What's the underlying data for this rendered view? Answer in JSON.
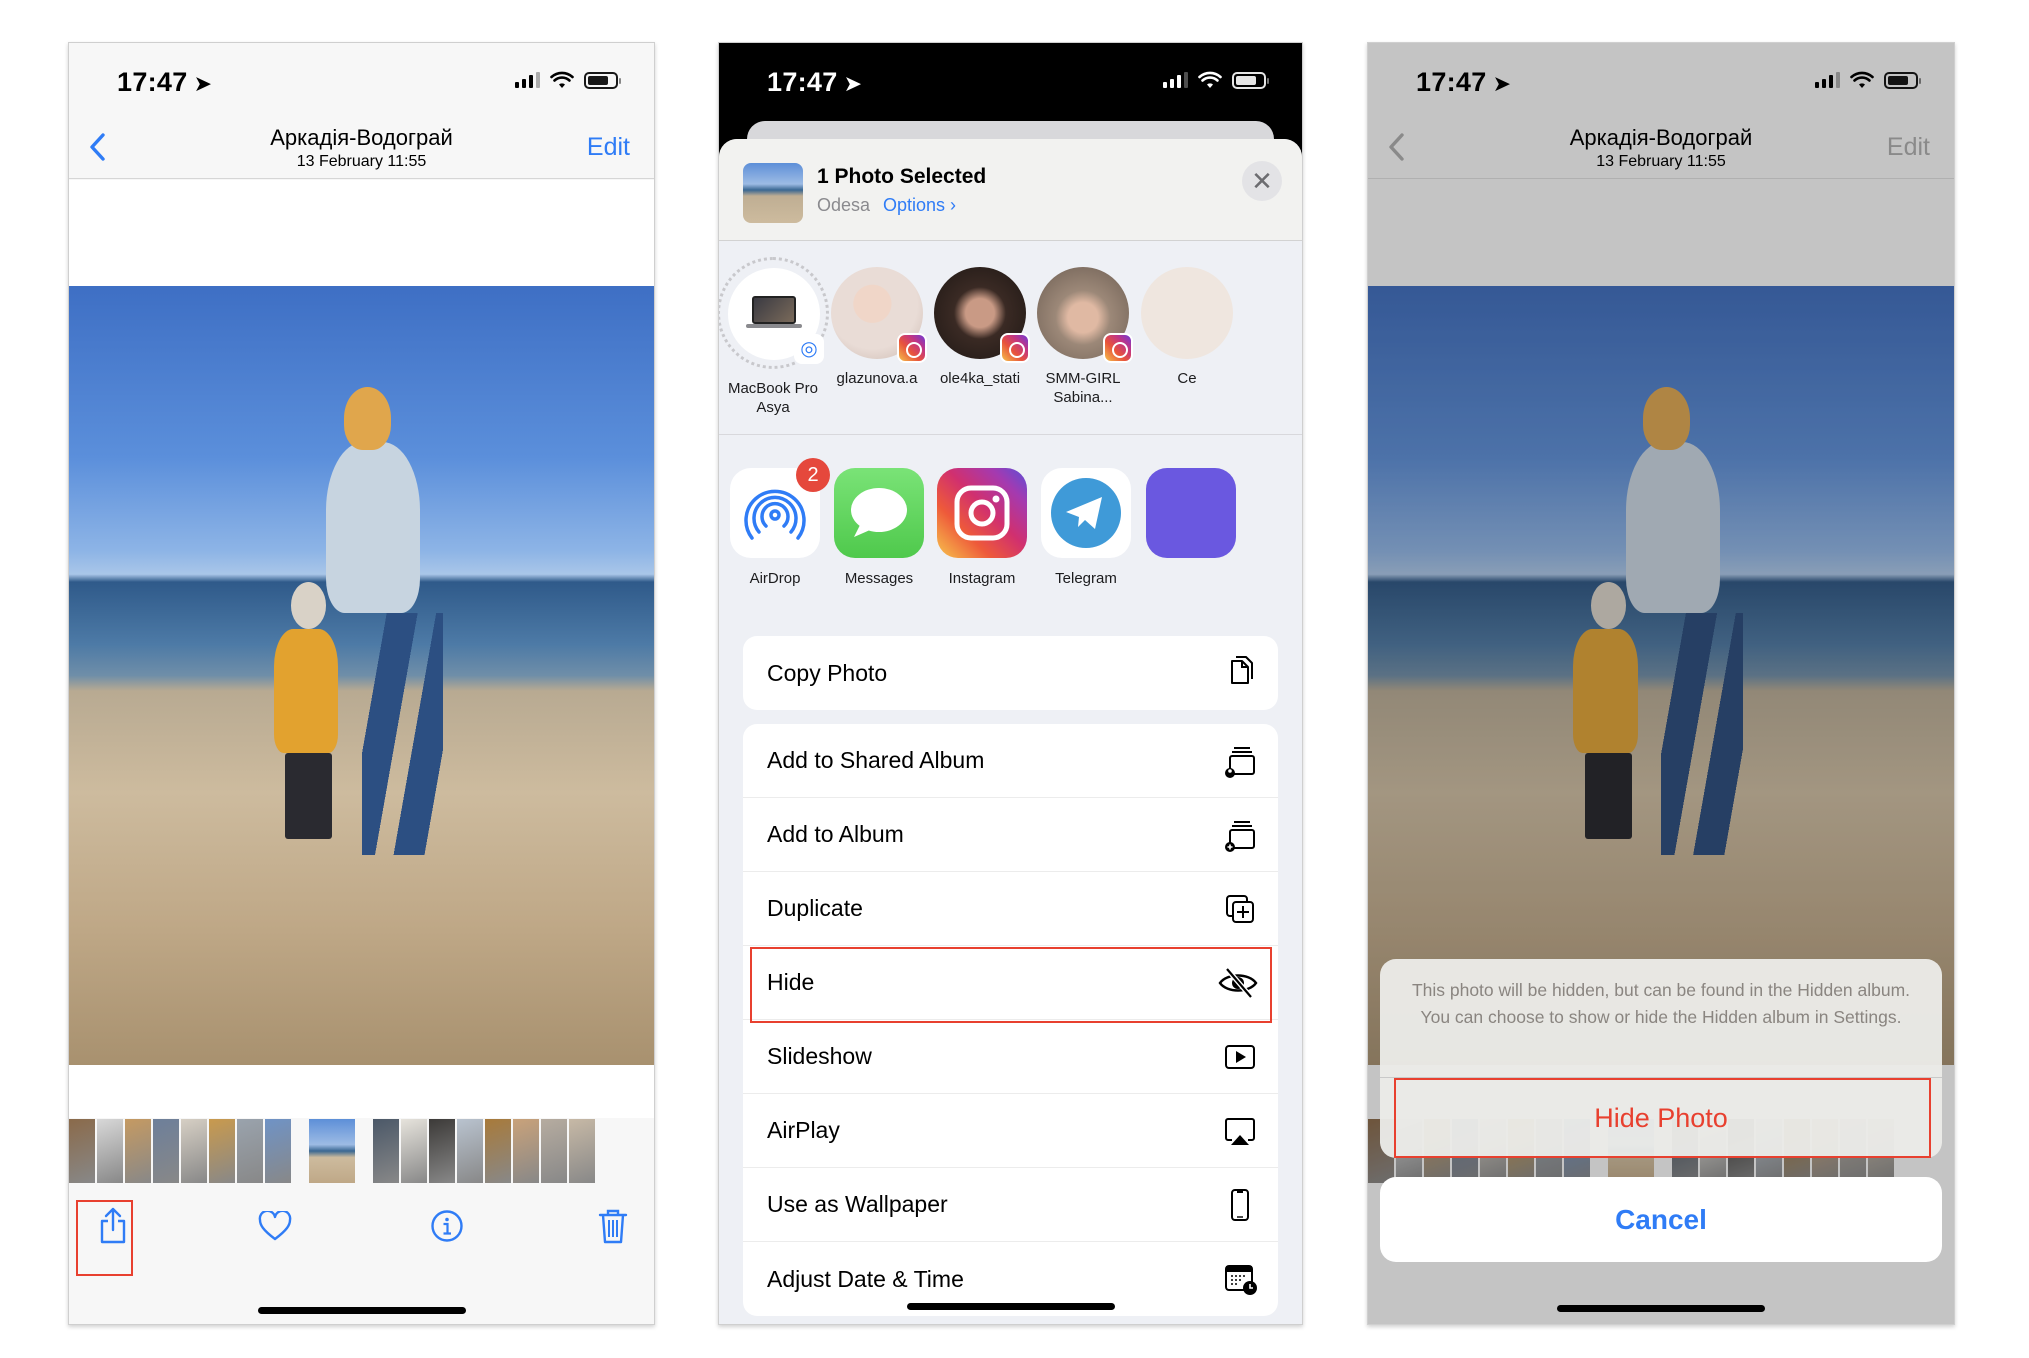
{
  "status_bar": {
    "time": "17:47",
    "location_icon": "location-arrow-icon"
  },
  "photo_view": {
    "title": "Аркадія-Водограй",
    "subtitle": "13 February  11:55",
    "back_icon": "chevron-left-icon",
    "edit_label": "Edit",
    "toolbar": [
      {
        "name": "share-button",
        "icon": "share-icon"
      },
      {
        "name": "favorite-button",
        "icon": "heart-icon"
      },
      {
        "name": "info-button",
        "icon": "info-icon"
      },
      {
        "name": "delete-button",
        "icon": "trash-icon"
      }
    ],
    "thumbnail_colors": [
      "#8a6a4a",
      "#d8d8d8",
      "#c59a62",
      "#6d7f9a",
      "#d6cfc4",
      "#c99a4d",
      "#9aa3ad",
      "#6f93c6",
      "gap",
      "#6f93c6",
      "gap",
      "#4b5868",
      "#e6e3dc",
      "#3c3a38",
      "#b9c3cf",
      "#a87a3a",
      "#c9a27a",
      "#b6aca0",
      "#c7b9a6"
    ]
  },
  "share_sheet": {
    "title": "1 Photo Selected",
    "location": "Odesa",
    "options_label": "Options ›",
    "close_icon": "close-icon",
    "people": [
      {
        "name": "MacBook Pro\nAsya",
        "line1": "MacBook Pro",
        "line2": "Asya",
        "type": "airdrop-device"
      },
      {
        "name": "glazunova.a",
        "line1": "glazunova.a",
        "line2": "",
        "type": "instagram",
        "color": "#e9dcd6"
      },
      {
        "name": "ole4ka_stati",
        "line1": "ole4ka_stati",
        "line2": "",
        "type": "instagram",
        "color": "#3a2a24"
      },
      {
        "name": "SMM-GIRL Sabina...",
        "line1": "SMM-GIRL",
        "line2": "Sabina...",
        "type": "instagram",
        "color": "#9c8878"
      },
      {
        "name": "Ce",
        "line1": "Ce",
        "line2": "",
        "type": "partial",
        "color": "#efe6df"
      }
    ],
    "apps": [
      {
        "name": "AirDrop",
        "badge": "2"
      },
      {
        "name": "Messages"
      },
      {
        "name": "Instagram"
      },
      {
        "name": "Telegram"
      }
    ],
    "actions_group1": [
      {
        "label": "Copy Photo",
        "icon": "copy-icon"
      }
    ],
    "actions_group2": [
      {
        "label": "Add to Shared Album",
        "icon": "shared-album-icon"
      },
      {
        "label": "Add to Album",
        "icon": "add-album-icon"
      },
      {
        "label": "Duplicate",
        "icon": "duplicate-icon"
      },
      {
        "label": "Hide",
        "icon": "eye-slash-icon",
        "highlighted": true
      },
      {
        "label": "Slideshow",
        "icon": "play-icon"
      },
      {
        "label": "AirPlay",
        "icon": "airplay-icon"
      },
      {
        "label": "Use as Wallpaper",
        "icon": "phone-icon"
      },
      {
        "label": "Adjust Date & Time",
        "icon": "calendar-clock-icon"
      }
    ]
  },
  "hide_alert": {
    "message": "This photo will be hidden, but can be found in the Hidden album. You can choose to show or hide the Hidden album in Settings.",
    "confirm_label": "Hide Photo",
    "cancel_label": "Cancel"
  },
  "colors": {
    "accent": "#2f7cf6",
    "destructive": "#e8402f",
    "highlight_box": "#e8402f"
  }
}
